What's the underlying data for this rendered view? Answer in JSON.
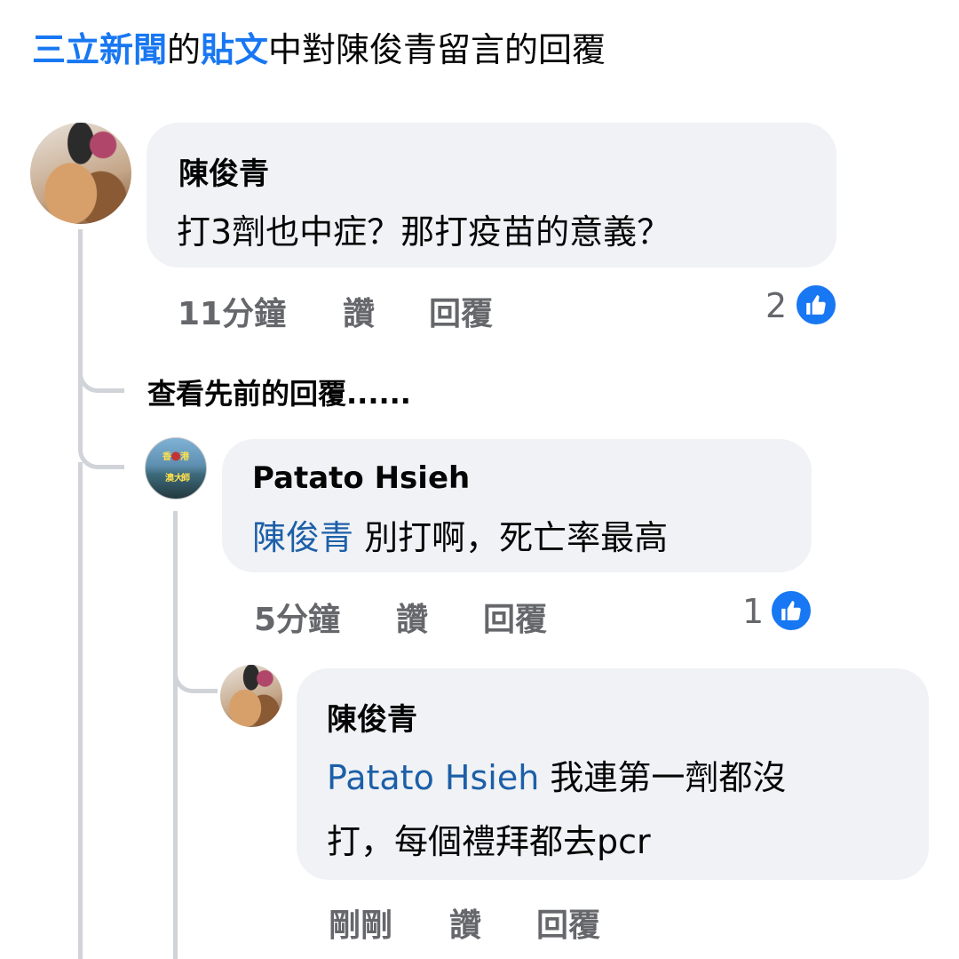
{
  "header": {
    "page_name": "三立新聞",
    "sep1": "的",
    "post": "貼文",
    "rest": "中對陳俊青留言的回覆"
  },
  "comment1": {
    "author": "陳俊青",
    "text": "打3劑也中症？那打疫苗的意義？",
    "time": "11分鐘",
    "like": "讚",
    "reply": "回覆",
    "reaction_count": "2"
  },
  "view_more": "查看先前的回覆......",
  "reply1": {
    "author": "Patato Hsieh",
    "avatar_text": [
      "香",
      "港",
      "澳大",
      "師"
    ],
    "mention": "陳俊青",
    "text": " 別打啊，死亡率最高",
    "time": "5分鐘",
    "like": "讚",
    "reply": "回覆",
    "reaction_count": "1"
  },
  "reply2": {
    "author": "陳俊青",
    "mention": "Patato Hsieh",
    "text_line1": " 我連第一劑都沒",
    "text_line2": "打，每個禮拜都去pcr",
    "time": "剛剛",
    "like": "讚",
    "reply": "回覆"
  },
  "colors": {
    "accent": "#1877f2",
    "mention": "#1c5fa8",
    "bubble": "#f0f2f5",
    "meta": "#65676b"
  }
}
